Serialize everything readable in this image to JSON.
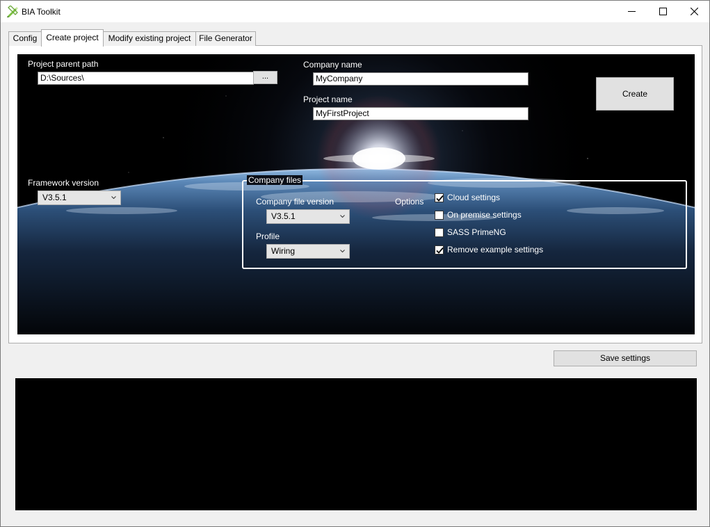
{
  "window": {
    "title": "BIA Toolkit",
    "icon": "pencil-ruler-icon",
    "controls": [
      "minimize-icon",
      "maximize-icon",
      "close-icon"
    ]
  },
  "tabs": [
    {
      "label": "Config",
      "active": false
    },
    {
      "label": "Create project",
      "active": true
    },
    {
      "label": "Modify existing project",
      "active": false
    },
    {
      "label": "File Generator",
      "active": false
    }
  ],
  "create_project": {
    "project_parent_path": {
      "label": "Project parent path",
      "value": "D:\\Sources\\",
      "browse_label": "..."
    },
    "company_name": {
      "label": "Company name",
      "value": "MyCompany"
    },
    "project_name": {
      "label": "Project name",
      "value": "MyFirstProject"
    },
    "create_label": "Create",
    "framework_version": {
      "label": "Framework version",
      "value": "V3.5.1"
    },
    "company_files": {
      "title": "Company files",
      "file_version": {
        "label": "Company file version",
        "value": "V3.5.1"
      },
      "profile": {
        "label": "Profile",
        "value": "Wiring"
      },
      "options_label": "Options",
      "options": [
        {
          "label": "Cloud settings",
          "checked": true
        },
        {
          "label": "On premise settings",
          "checked": false
        },
        {
          "label": "SASS PrimeNG",
          "checked": false
        },
        {
          "label": "Remove example settings",
          "checked": true
        }
      ]
    }
  },
  "save_settings_label": "Save settings",
  "colors": {
    "background_scene": "#000000",
    "planet_glow": "#9fc4e8",
    "label_text": "#ffffff"
  }
}
